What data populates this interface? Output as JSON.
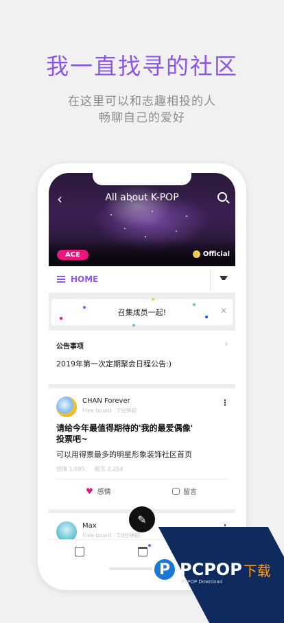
{
  "promo": {
    "headline": "我一直找寻的社区",
    "sub_line1": "在这里可以和志趣相投的人",
    "sub_line2": "畅聊自己的爱好"
  },
  "community": {
    "title": "All about K-POP",
    "badge": "ACE",
    "official_label": "Official"
  },
  "nav": {
    "home_label": "HOME"
  },
  "banner": {
    "text": "召集成员一起!"
  },
  "notice": {
    "title": "公告事项",
    "item": "2019年第一次定期聚会日程公告:)"
  },
  "post1": {
    "author": "CHAN Forever",
    "meta": "Free board · 7分钟前",
    "title_line1": "请给今年最值得期待的'我的最爱偶像'",
    "title_line2": "投票吧~",
    "body": "可以用得票最多的明星形象装饰社区首页",
    "likes_stat": "感情 1,095",
    "comments_stat": "留言 2,254",
    "like_label": "感情",
    "comment_label": "留言"
  },
  "post2": {
    "author": "Max",
    "meta": "Free board · 10分钟前"
  },
  "watermark": {
    "brand": "PCPOP",
    "brand_suffix": "下载",
    "sub": "PCPOP Download"
  },
  "colors": {
    "accent": "#8b56e8",
    "badge": "#e8177d",
    "official_dot": "#f2c94c"
  }
}
